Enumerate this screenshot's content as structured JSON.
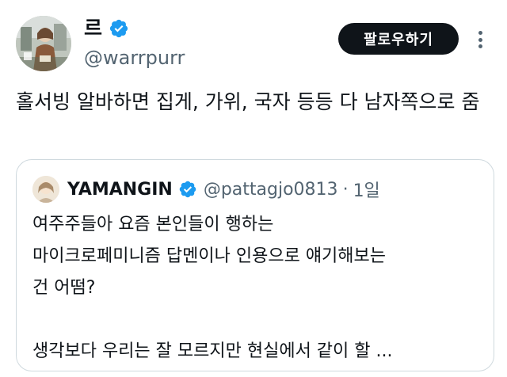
{
  "author": {
    "display_name": "르",
    "handle": "@warrpurr",
    "verified": true,
    "avatar_icon": "user-avatar-photo"
  },
  "actions": {
    "follow_label": "팔로우하기",
    "more_icon": "more-options-icon"
  },
  "tweet": {
    "text": "홀서빙 알바하면 집게, 가위, 국자 등등 다 남자쪽으로 줌"
  },
  "quoted_tweet": {
    "display_name": "YAMANGIN",
    "handle": "@pattagjo0813",
    "separator": "·",
    "time": "1일",
    "verified": true,
    "lines": [
      "여주주들아 요즘 본인들이 행하는",
      "마이크로페미니즘 답멘이나 인용으로 얘기해보는",
      "건 어떰?",
      "",
      "생각보다 우리는 잘 모르지만 현실에서 같이 할 ..."
    ]
  },
  "colors": {
    "text_primary": "#0f1419",
    "text_secondary": "#536471",
    "verified_blue": "#1d9bf0",
    "border": "#cfd9de",
    "button_bg": "#0f1419",
    "button_text": "#ffffff"
  }
}
